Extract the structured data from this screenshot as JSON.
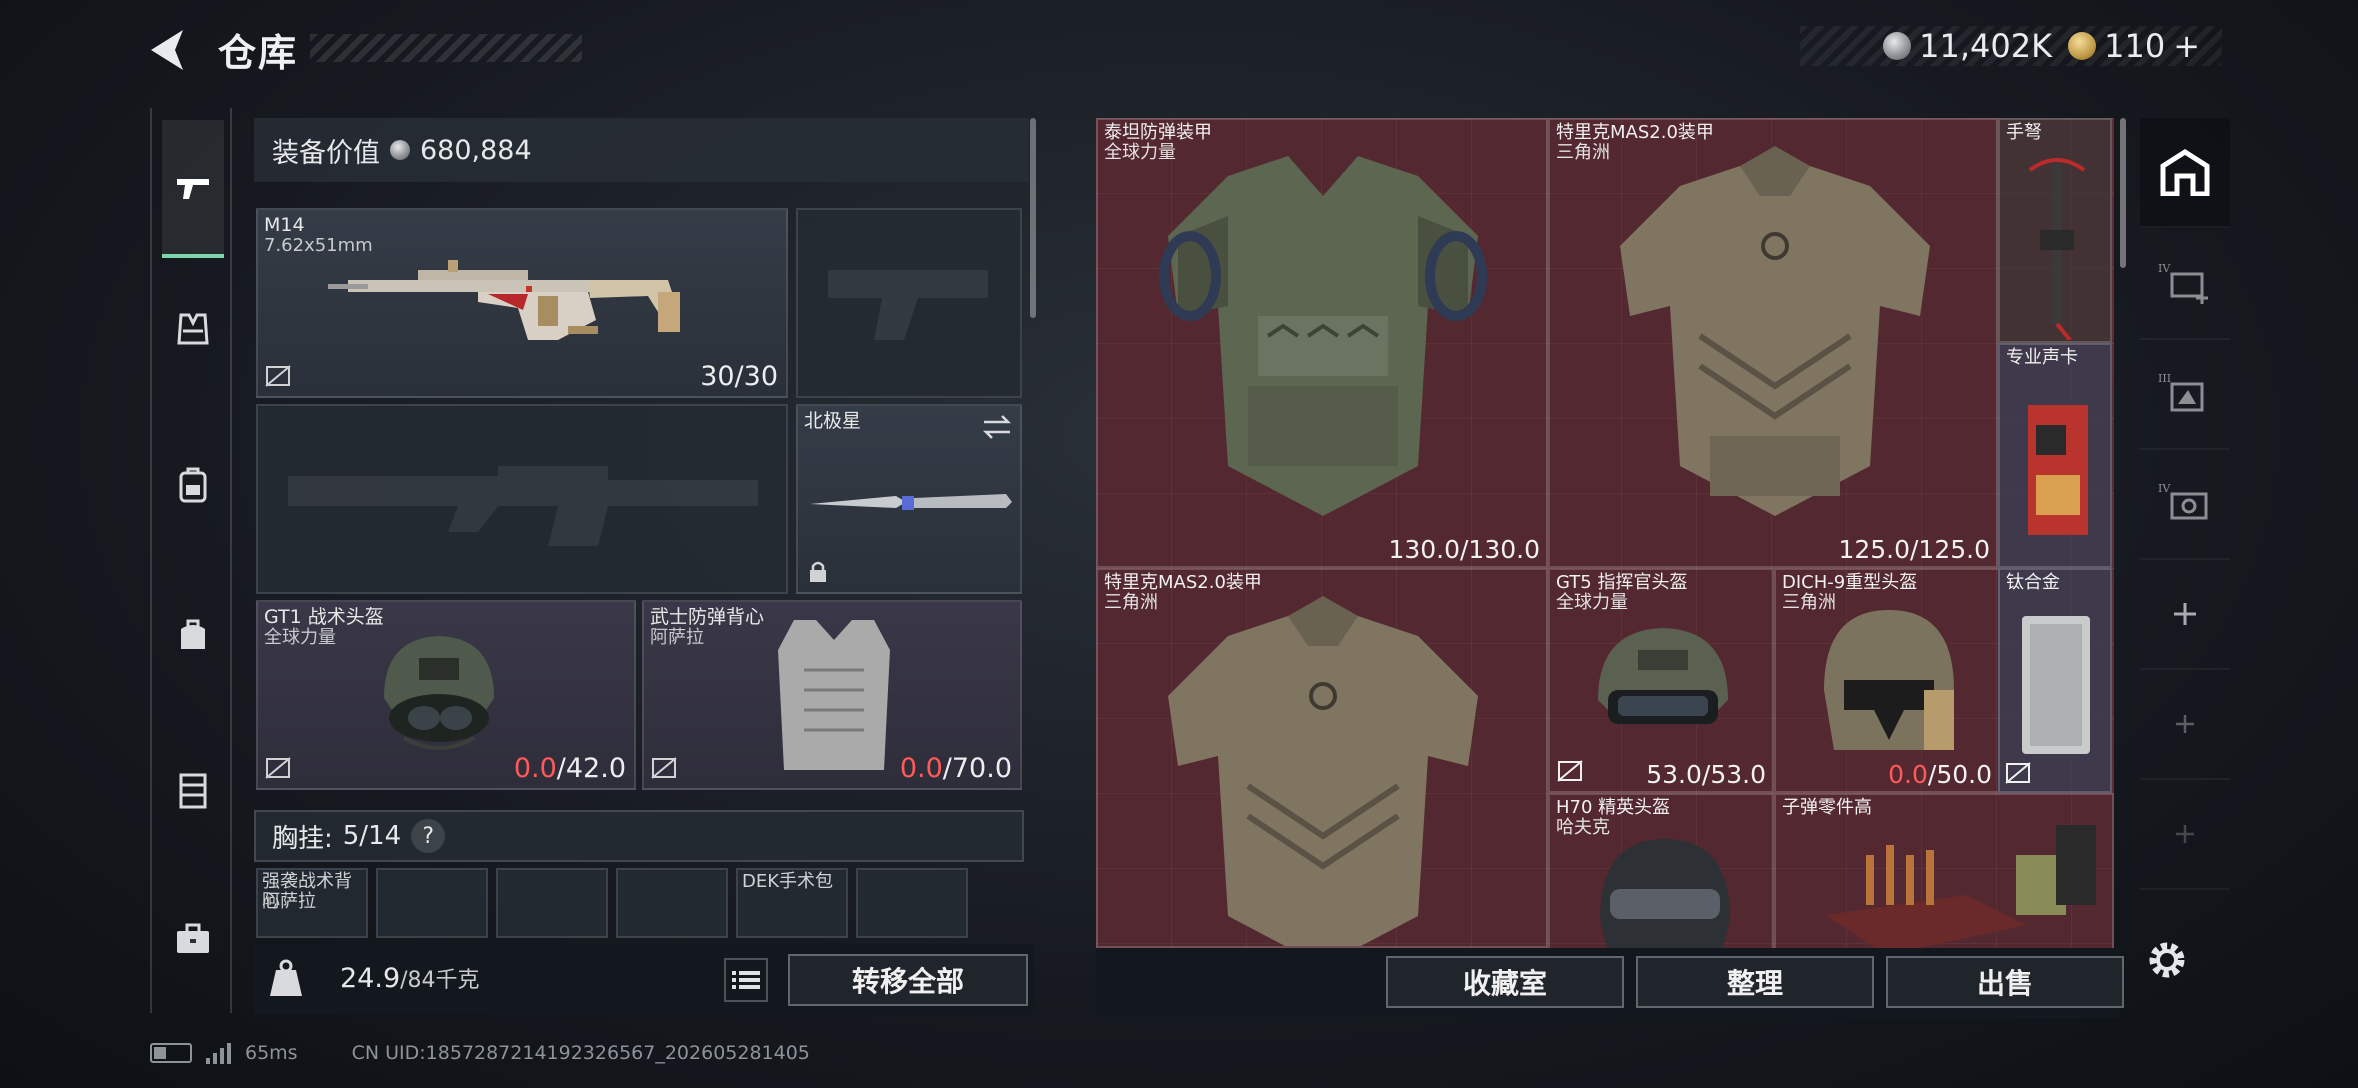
{
  "header": {
    "title": "仓库"
  },
  "currency": {
    "silver": "11,402K",
    "gold": "110",
    "gold_plus": "+"
  },
  "left_nav": [
    "weapon",
    "armor",
    "backpack",
    "bag",
    "locker",
    "case"
  ],
  "equipment": {
    "value_label": "装备价值",
    "value": "680,884",
    "primary": {
      "name": "M14",
      "ammo_type": "7.62x51mm",
      "ammo": "30/30"
    },
    "melee": {
      "name": "北极星"
    },
    "helmet": {
      "name": "GT1 战术头盔",
      "maker": "全球力量",
      "dur_cur": "0.0",
      "dur_max": "/42.0"
    },
    "armor": {
      "name": "武士防弹背心",
      "maker": "阿萨拉",
      "dur_cur": "0.0",
      "dur_max": "/70.0"
    },
    "chest_rig": {
      "label": "胸挂:",
      "value": "5/14",
      "help": "?"
    },
    "chest_slots": [
      {
        "label": "强袭战术背心",
        "sub": "阿萨拉"
      },
      {
        "label": "",
        "sub": ""
      },
      {
        "label": "",
        "sub": ""
      },
      {
        "label": "",
        "sub": ""
      },
      {
        "label": "DEK手术包",
        "sub": ""
      },
      {
        "label": "",
        "sub": ""
      }
    ],
    "weight": {
      "current": "24.9",
      "max": "/84千克"
    },
    "transfer_all": "转移全部"
  },
  "stash_items": {
    "i1": {
      "name": "泰坦防弹装甲",
      "sub": "全球力量",
      "dur": "130.0/130.0"
    },
    "i2": {
      "name": "特里克MAS2.0装甲",
      "sub": "三角洲",
      "dur": "125.0/125.0"
    },
    "i3": {
      "name": "手弩"
    },
    "i4": {
      "name": "专业声卡"
    },
    "i5": {
      "name": "特里克MAS2.0装甲",
      "sub": "三角洲"
    },
    "i6": {
      "name": "GT5 指挥官头盔",
      "sub": "全球力量",
      "dur": "53.0/53.0"
    },
    "i7": {
      "name": "DICH-9重型头盔",
      "sub": "三角洲",
      "dur_cur": "0.0",
      "dur_max": "/50.0"
    },
    "i8": {
      "name": "钛合金"
    },
    "i9": {
      "name": "H70 精英头盔",
      "sub": "哈夫克"
    },
    "i10": {
      "name": "子弹零件高"
    }
  },
  "right_tabs": [
    "home-icon",
    "locker-IV-icon",
    "locker-III-icon",
    "locker-IV-2-icon",
    "add-icon",
    "add-icon",
    "add-icon"
  ],
  "stash_buttons": {
    "collection": "收藏室",
    "sort": "整理",
    "sell": "出售"
  },
  "status": {
    "ping": "65ms",
    "uid": "CN UID:1857287214192326567_202605281405"
  },
  "colors": {
    "accent": "#7ed6a8",
    "red": "#ff5a5a",
    "stash_bg": "#5a2c33"
  }
}
